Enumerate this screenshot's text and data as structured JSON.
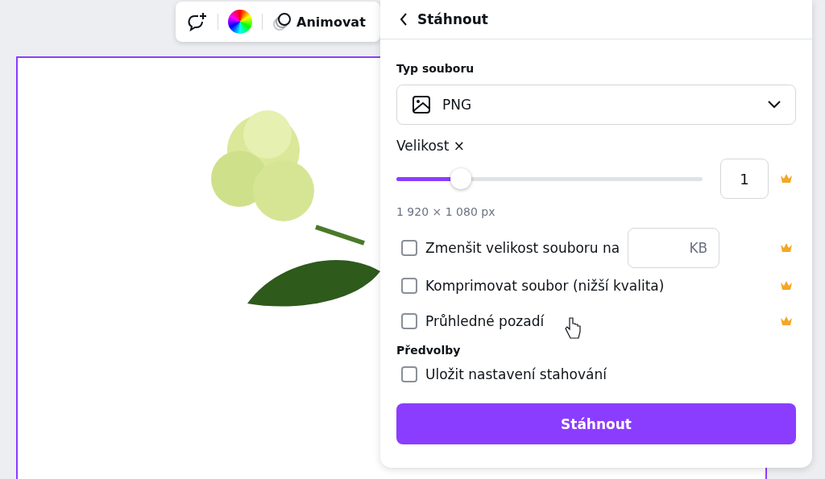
{
  "toolbar": {
    "animate_label": "Animovat"
  },
  "panel": {
    "title": "Stáhnout",
    "file_type": {
      "label": "Typ souboru",
      "value": "PNG"
    },
    "size": {
      "label": "Velikost ×",
      "level": 0.21,
      "value": "1",
      "premium": true,
      "dimensions": "1 920 × 1 080 px"
    },
    "options": [
      {
        "kind": "field",
        "label": "Zmenšit velikost souboru na",
        "checked": false,
        "premium": true,
        "placeholder": "KB"
      },
      {
        "kind": "plain",
        "label": "Komprimovat soubor (nižší kvalita)",
        "checked": false,
        "premium": true
      },
      {
        "kind": "plain",
        "label": "Průhledné pozadí",
        "checked": false,
        "premium": true
      }
    ],
    "presets": {
      "label": "Předvolby",
      "options": [
        {
          "kind": "plain",
          "label": "Uložit nastavení stahování",
          "checked": false
        }
      ]
    },
    "download_button": "Stáhnout"
  }
}
